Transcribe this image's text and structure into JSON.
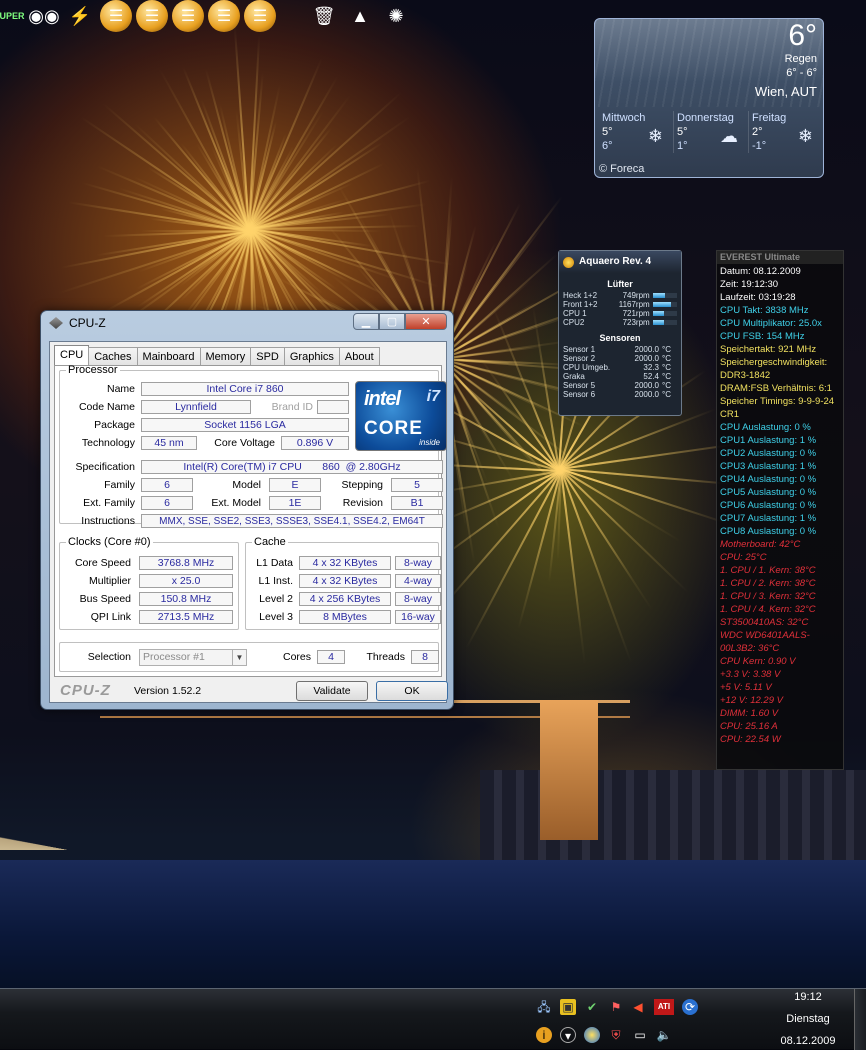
{
  "top_icons": [
    {
      "name": "super-pi-icon",
      "label": "UPER",
      "style": "plain"
    },
    {
      "name": "robot-gadget-icon",
      "label": "◉◉",
      "style": "plain"
    },
    {
      "name": "lightning-gadget-icon",
      "label": "⚡",
      "style": "plain"
    },
    {
      "name": "menu-gadget-icon-1",
      "label": "☰",
      "style": "orange"
    },
    {
      "name": "menu-gadget-icon-2",
      "label": "☰",
      "style": "orange"
    },
    {
      "name": "menu-gadget-icon-3",
      "label": "☰",
      "style": "orange"
    },
    {
      "name": "menu-gadget-icon-4",
      "label": "☰",
      "style": "orange"
    },
    {
      "name": "menu-gadget-icon-5",
      "label": "☰",
      "style": "orange"
    },
    {
      "name": "recycle-bin-icon",
      "label": "🗑",
      "style": "plain"
    },
    {
      "name": "wizard-hat-icon",
      "label": "▲",
      "style": "plain"
    },
    {
      "name": "red-emblem-icon",
      "label": "✺",
      "style": "plain"
    }
  ],
  "weather": {
    "temp": "6°",
    "condition": "Regen",
    "range": "6° - 6°",
    "location": "Wien, AUT",
    "days": [
      {
        "name": "Mittwoch",
        "high": "5°",
        "low": "6°",
        "icon": "❄"
      },
      {
        "name": "Donnerstag",
        "high": "5°",
        "low": "1°",
        "icon": "☁"
      },
      {
        "name": "Freitag",
        "high": "2°",
        "low": "-1°",
        "icon": "❄"
      }
    ],
    "footer": "© Foreca"
  },
  "aquaero": {
    "title": "Aquaero Rev. 4",
    "fans_header": "Lüfter",
    "fans": [
      {
        "label": "Heck 1+2",
        "value": "749",
        "unit": "rpm",
        "level": 0.5
      },
      {
        "label": "Front 1+2",
        "value": "1167",
        "unit": "rpm",
        "level": 0.75
      },
      {
        "label": "CPU 1",
        "value": "721",
        "unit": "rpm",
        "level": 0.48
      },
      {
        "label": "CPU2",
        "value": "723",
        "unit": "rpm",
        "level": 0.48
      }
    ],
    "sensors_header": "Sensoren",
    "sensors": [
      {
        "label": "Sensor 1",
        "value": "2000.0",
        "unit": "°C"
      },
      {
        "label": "Sensor 2",
        "value": "2000.0",
        "unit": "°C"
      },
      {
        "label": "CPU Umgeb.",
        "value": "32.3",
        "unit": "°C"
      },
      {
        "label": "Graka",
        "value": "52.4",
        "unit": "°C"
      },
      {
        "label": "Sensor 5",
        "value": "2000.0",
        "unit": "°C"
      },
      {
        "label": "Sensor 6",
        "value": "2000.0",
        "unit": "°C"
      }
    ]
  },
  "everest": {
    "title": "EVEREST Ultimate",
    "lines": [
      {
        "text": "Datum: 08.12.2009",
        "cls": "w"
      },
      {
        "text": "Zeit: 19:12:30",
        "cls": "w"
      },
      {
        "text": "Laufzeit: 03:19:28",
        "cls": "w"
      },
      {
        "text": "CPU Takt: 3838 MHz",
        "cls": "c"
      },
      {
        "text": "CPU Multiplikator: 25.0x",
        "cls": "c"
      },
      {
        "text": "CPU FSB: 154 MHz",
        "cls": "c"
      },
      {
        "text": "Speichertakt: 921 MHz",
        "cls": "y"
      },
      {
        "text": "Speichergeschwindigkeit: DDR3-1842",
        "cls": "y"
      },
      {
        "text": "DRAM:FSB Verhältnis: 6:1",
        "cls": "y"
      },
      {
        "text": "Speicher Timings: 9-9-9-24 CR1",
        "cls": "y"
      },
      {
        "text": "CPU Auslastung: 0 %",
        "cls": "c"
      },
      {
        "text": "CPU1 Auslastung: 1 %",
        "cls": "c"
      },
      {
        "text": "CPU2 Auslastung: 0 %",
        "cls": "c"
      },
      {
        "text": "CPU3 Auslastung: 1 %",
        "cls": "c"
      },
      {
        "text": "CPU4 Auslastung: 0 %",
        "cls": "c"
      },
      {
        "text": "CPU5 Auslastung: 0 %",
        "cls": "c"
      },
      {
        "text": "CPU6 Auslastung: 0 %",
        "cls": "c"
      },
      {
        "text": "CPU7 Auslastung: 1 %",
        "cls": "c"
      },
      {
        "text": "CPU8 Auslastung: 0 %",
        "cls": "c"
      },
      {
        "text": "Motherboard: 42°C",
        "cls": "r"
      },
      {
        "text": "CPU: 25°C",
        "cls": "r"
      },
      {
        "text": "1. CPU / 1. Kern: 38°C",
        "cls": "r"
      },
      {
        "text": "1. CPU / 2. Kern: 38°C",
        "cls": "r"
      },
      {
        "text": "1. CPU / 3. Kern: 32°C",
        "cls": "r"
      },
      {
        "text": "1. CPU / 4. Kern: 32°C",
        "cls": "r"
      },
      {
        "text": "ST3500410AS: 32°C",
        "cls": "r"
      },
      {
        "text": "WDC WD6401AALS-00L3B2: 36°C",
        "cls": "r"
      },
      {
        "text": "CPU Kern: 0.90 V",
        "cls": "r"
      },
      {
        "text": "+3.3 V: 3.38 V",
        "cls": "r"
      },
      {
        "text": "+5 V: 5.11 V",
        "cls": "r"
      },
      {
        "text": "+12 V: 12.29 V",
        "cls": "r"
      },
      {
        "text": "DIMM: 1.60 V",
        "cls": "r"
      },
      {
        "text": "CPU: 25.16 A",
        "cls": "r"
      },
      {
        "text": "CPU: 22.54 W",
        "cls": "r"
      }
    ]
  },
  "cpuz": {
    "title": "CPU-Z",
    "tabs": [
      "CPU",
      "Caches",
      "Mainboard",
      "Memory",
      "SPD",
      "Graphics",
      "About"
    ],
    "processor_legend": "Processor",
    "name_label": "Name",
    "name": "Intel Core i7 860",
    "codename_label": "Code Name",
    "codename": "Lynnfield",
    "brandid_label": "Brand ID",
    "package_label": "Package",
    "package": "Socket 1156 LGA",
    "technology_label": "Technology",
    "technology": "45 nm",
    "corevoltage_label": "Core Voltage",
    "corevoltage": "0.896 V",
    "spec_label": "Specification",
    "spec": "Intel(R) Core(TM) i7 CPU       860  @ 2.80GHz",
    "family_label": "Family",
    "family": "6",
    "model_label": "Model",
    "model": "E",
    "stepping_label": "Stepping",
    "stepping": "5",
    "extfamily_label": "Ext. Family",
    "extfamily": "6",
    "extmodel_label": "Ext. Model",
    "extmodel": "1E",
    "revision_label": "Revision",
    "revision": "B1",
    "instructions_label": "Instructions",
    "instructions": "MMX, SSE, SSE2, SSE3, SSSE3, SSE4.1, SSE4.2, EM64T",
    "logo": {
      "brand": "intel",
      "i7": "i7",
      "core": "CORE",
      "inside": "inside"
    },
    "clocks_legend": "Clocks (Core #0)",
    "corespeed_label": "Core Speed",
    "corespeed": "3768.8 MHz",
    "multiplier_label": "Multiplier",
    "multiplier": "x 25.0",
    "busspeed_label": "Bus Speed",
    "busspeed": "150.8 MHz",
    "qpi_label": "QPI Link",
    "qpi": "2713.5 MHz",
    "cache_legend": "Cache",
    "l1d_label": "L1 Data",
    "l1d": "4 x 32 KBytes",
    "l1d_way": "8-way",
    "l1i_label": "L1 Inst.",
    "l1i": "4 x 32 KBytes",
    "l1i_way": "4-way",
    "l2_label": "Level 2",
    "l2": "4 x 256 KBytes",
    "l2_way": "8-way",
    "l3_label": "Level 3",
    "l3": "8 MBytes",
    "l3_way": "16-way",
    "selection_label": "Selection",
    "selection": "Processor #1",
    "cores_label": "Cores",
    "cores": "4",
    "threads_label": "Threads",
    "threads": "8",
    "logo_text": "CPU-Z",
    "version": "Version 1.52.2",
    "validate": "Validate",
    "ok": "OK"
  },
  "taskbar": {
    "tray_icons": [
      "network-icon",
      "notes-icon",
      "shield-check-icon",
      "flag-x-icon",
      "speaker-icon",
      "ati-icon",
      "sync-icon",
      "info-icon",
      "safely-remove-icon",
      "aquaero-tray-icon",
      "defender-icon",
      "display-icon",
      "volume-icon"
    ],
    "time": "19:12",
    "day": "Dienstag",
    "date": "08.12.2009"
  }
}
